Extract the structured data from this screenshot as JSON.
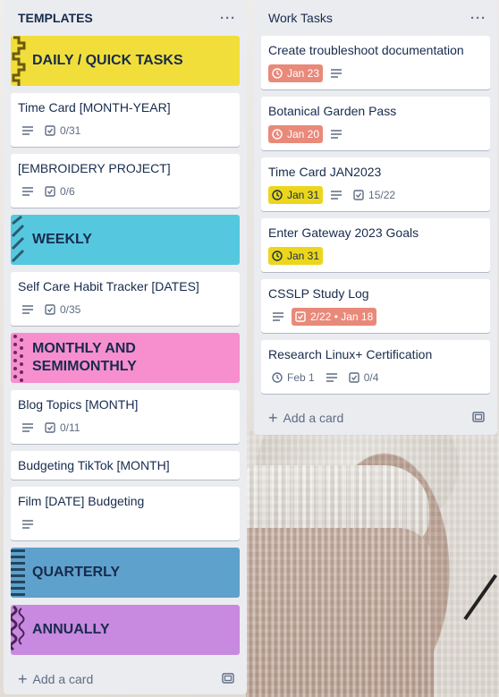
{
  "lists": {
    "templates": {
      "title": "TEMPLATES",
      "menu": "···",
      "add_card": "Add a card",
      "cards": {
        "daily": "DAILY / QUICK TASKS",
        "timecard": {
          "title": "Time Card [MONTH-YEAR]",
          "checklist": "0/31"
        },
        "embroidery": {
          "title": "[EMBROIDERY PROJECT]",
          "checklist": "0/6"
        },
        "weekly": "WEEKLY",
        "selfcare": {
          "title": "Self Care Habit Tracker [DATES]",
          "checklist": "0/35"
        },
        "monthly": "MONTHLY AND SEMIMONTHLY",
        "blog": {
          "title": "Blog Topics [MONTH]",
          "checklist": "0/11"
        },
        "budgeting": {
          "title": "Budgeting TikTok [MONTH]"
        },
        "film": {
          "title": "Film [DATE] Budgeting"
        },
        "quarterly": "QUARTERLY",
        "annually": "ANNUALLY"
      }
    },
    "work": {
      "title": "Work Tasks",
      "menu": "···",
      "add_card": "Add a card",
      "cards": {
        "troubleshoot": {
          "title": "Create troubleshoot documentation",
          "due": "Jan 23"
        },
        "botanical": {
          "title": "Botanical Garden Pass",
          "due": "Jan 20"
        },
        "timecard": {
          "title": "Time Card JAN2023",
          "due": "Jan 31",
          "checklist": "15/22"
        },
        "gateway": {
          "title": "Enter Gateway 2023 Goals",
          "due": "Jan 31"
        },
        "csslp": {
          "title": "CSSLP Study Log",
          "checklist": "2/22 • Jan 18"
        },
        "linux": {
          "title": "Research Linux+ Certification",
          "due": "Feb 1",
          "checklist": "0/4"
        }
      }
    }
  },
  "colors": {
    "daily": "#f2de3a",
    "weekly": "#55c8e0",
    "monthly": "#f78fcf",
    "quarterly": "#5ea1cc",
    "annually": "#c889e0",
    "due_red": "#e9897a",
    "due_yellow": "#ecd61c"
  }
}
